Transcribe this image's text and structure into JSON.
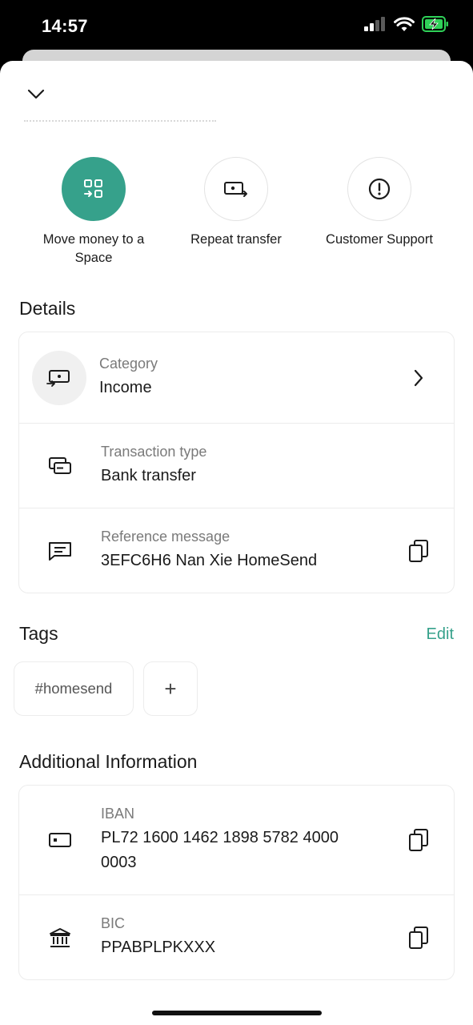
{
  "status_bar": {
    "time": "14:57"
  },
  "actions": [
    {
      "label": "Move money to a Space",
      "icon": "move-money-icon"
    },
    {
      "label": "Repeat transfer",
      "icon": "repeat-transfer-icon"
    },
    {
      "label": "Customer Support",
      "icon": "support-icon"
    }
  ],
  "details": {
    "title": "Details",
    "rows": [
      {
        "label": "Category",
        "value": "Income",
        "icon": "category-income-icon",
        "action_icon": "chevron-right-icon"
      },
      {
        "label": "Transaction type",
        "value": "Bank transfer",
        "icon": "bank-transfer-icon"
      },
      {
        "label": "Reference message",
        "value": "3EFC6H6 Nan Xie HomeSend",
        "icon": "message-icon",
        "action_icon": "copy-icon"
      }
    ]
  },
  "tags": {
    "title": "Tags",
    "edit_label": "Edit",
    "items": [
      "#homesend"
    ],
    "add_label": "+"
  },
  "additional": {
    "title": "Additional Information",
    "rows": [
      {
        "label": "IBAN",
        "value": "PL72 1600 1462 1898 5782 4000 0003",
        "icon": "card-icon",
        "action_icon": "copy-icon"
      },
      {
        "label": "BIC",
        "value": "PPABPLPKXXX",
        "icon": "bank-icon",
        "action_icon": "copy-icon"
      }
    ]
  },
  "colors": {
    "accent": "#36a18b",
    "text": "#1b1b1b",
    "muted": "#7a7a7a",
    "border": "#ececec"
  }
}
